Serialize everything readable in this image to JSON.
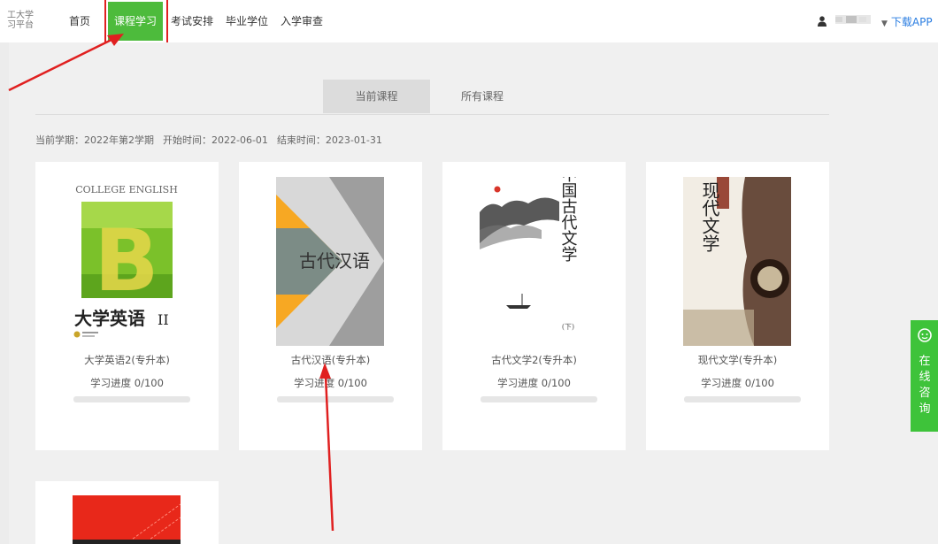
{
  "logo": {
    "line1": "工大学",
    "line2": "习平台"
  },
  "nav": {
    "items": [
      "首页",
      "课程学习",
      "考试安排",
      "毕业学位",
      "入学审查"
    ],
    "active_index": 1
  },
  "user": {
    "download_label": "下载APP"
  },
  "tabs": {
    "current": "当前课程",
    "all": "所有课程"
  },
  "term": {
    "semester": "当前学期：2022年第2学期",
    "start": "开始时间：2022-06-01",
    "end": "结束时间：2023-01-31"
  },
  "courses": [
    {
      "name": "大学英语2(专升本)",
      "progress_text": "学习进度 0/100",
      "progress": 0,
      "cover": {
        "top_text": "COLLEGE ENGLISH",
        "big_letter": "B",
        "bottom_text": "大学英语",
        "roman": "II"
      }
    },
    {
      "name": "古代汉语(专升本)",
      "progress_text": "学习进度 0/100",
      "progress": 0,
      "cover": {
        "text": "古代汉语"
      }
    },
    {
      "name": "古代文学2(专升本)",
      "progress_text": "学习进度 0/100",
      "progress": 0,
      "cover": {
        "vertical_text": "中国古代文学",
        "sub": "(下)"
      }
    },
    {
      "name": "现代文学(专升本)",
      "progress_text": "学习进度 0/100",
      "progress": 0,
      "cover": {
        "vertical_text": "现代文学"
      }
    }
  ],
  "consult": {
    "label": "在线咨询"
  },
  "colors": {
    "accent": "#4dbb3c",
    "annotation": "#e02020",
    "link": "#2a7de1"
  }
}
